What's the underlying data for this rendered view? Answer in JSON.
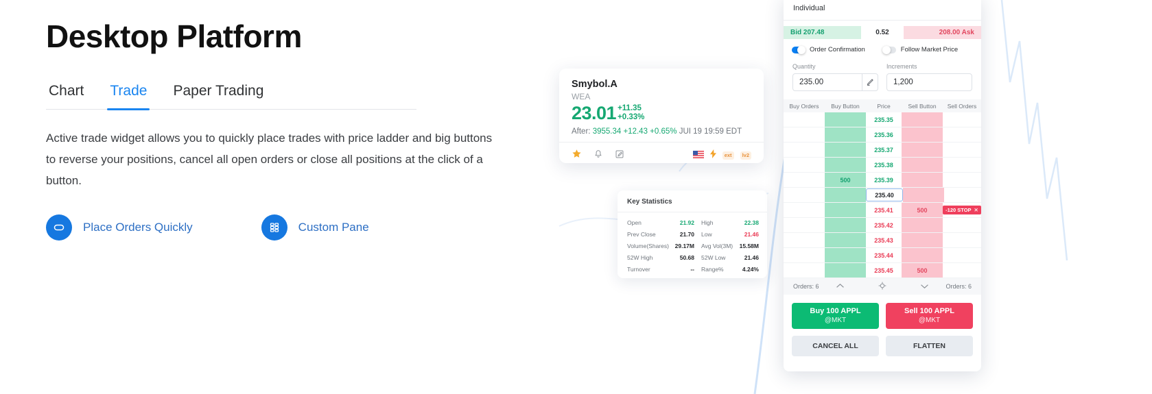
{
  "hero": {
    "title": "Desktop Platform",
    "tabs": [
      {
        "label": "Chart",
        "active": false
      },
      {
        "label": "Trade",
        "active": true
      },
      {
        "label": "Paper Trading",
        "active": false
      }
    ],
    "description": "Active trade widget allows you to quickly place trades with price ladder and big buttons to reverse your positions, cancel all open orders or close all positions at the click of a button.",
    "links": [
      {
        "label": "Place Orders Quickly",
        "icon": "pill-button-icon"
      },
      {
        "label": "Custom Pane",
        "icon": "grid-panes-icon"
      }
    ],
    "accent_color": "#1a85f0",
    "link_color": "#2d6fc4"
  },
  "quote_card": {
    "symbol": "Smybol.A",
    "exchange": "WEA",
    "price": "23.01",
    "change": "+11.35",
    "change_pct": "+0.33%",
    "after_label": "After:",
    "after_price": "3955.34",
    "after_change": "+12.43",
    "after_pct": "+0.65%",
    "after_time": "JUI 19 19:59 EDT",
    "icons": [
      "star-icon",
      "bell-icon",
      "note-edit-icon"
    ],
    "right_icons": [
      "us-flag-icon",
      "lightning-icon",
      "tag-ext-icon",
      "tag-lv2-icon"
    ],
    "tag1": "ext",
    "tag2": "lv2",
    "up_color": "#16a872"
  },
  "key_statistics": {
    "title": "Key Statistics",
    "rows": [
      {
        "l1": "Open",
        "v1": "21.92",
        "v1_color": "green",
        "l2": "High",
        "v2": "22.38",
        "v2_color": "green"
      },
      {
        "l1": "Prev Close",
        "v1": "21.70",
        "v1_color": "dark",
        "l2": "Low",
        "v2": "21.46",
        "v2_color": "red"
      },
      {
        "l1": "Volume(Shares)",
        "v1": "29.17M",
        "v1_color": "dark",
        "l2": "Avg Vol(3M)",
        "v2": "15.58M",
        "v2_color": "dark"
      },
      {
        "l1": "52W High",
        "v1": "50.68",
        "v1_color": "dark",
        "l2": "52W Low",
        "v2": "21.46",
        "v2_color": "dark"
      },
      {
        "l1": "Turnover",
        "v1": "--",
        "v1_color": "dark",
        "l2": "Range%",
        "v2": "4.24%",
        "v2_color": "dark"
      }
    ]
  },
  "trade_panel": {
    "account": "Individual",
    "bid_label": "Bid 207.48",
    "spread": "0.52",
    "ask_label": "208.00  Ask",
    "toggles": [
      {
        "label": "Order Confirmation",
        "on": true
      },
      {
        "label": "Follow Market Price",
        "on": false
      }
    ],
    "quantity_label": "Quantity",
    "quantity_value": "235.00",
    "increments_label": "Increments",
    "increments_value": "1,200",
    "pencil_icon": "pencil-icon",
    "ladder_headers": [
      "Buy Orders",
      "Buy Button",
      "Price",
      "Sell Button",
      "Sell Orders"
    ],
    "ladder_rows": [
      {
        "buy_orders": "",
        "buy_qty": "",
        "price": "235.35",
        "price_side": "buy",
        "sell_qty": "",
        "sell_orders": "",
        "current": false
      },
      {
        "buy_orders": "",
        "buy_qty": "",
        "price": "235.36",
        "price_side": "buy",
        "sell_qty": "",
        "sell_orders": "",
        "current": false
      },
      {
        "buy_orders": "",
        "buy_qty": "",
        "price": "235.37",
        "price_side": "buy",
        "sell_qty": "",
        "sell_orders": "",
        "current": false
      },
      {
        "buy_orders": "",
        "buy_qty": "",
        "price": "235.38",
        "price_side": "buy",
        "sell_qty": "",
        "sell_orders": "",
        "current": false
      },
      {
        "buy_orders": "",
        "buy_qty": "500",
        "price": "235.39",
        "price_side": "buy",
        "sell_qty": "",
        "sell_orders": "",
        "current": false
      },
      {
        "buy_orders": "",
        "buy_qty": "",
        "price": "235.40",
        "price_side": "current",
        "sell_qty": "",
        "sell_orders": "",
        "current": true
      },
      {
        "buy_orders": "",
        "buy_qty": "",
        "price": "235.41",
        "price_side": "sell",
        "sell_qty": "500",
        "sell_orders": "-120 STOP",
        "current": false
      },
      {
        "buy_orders": "",
        "buy_qty": "",
        "price": "235.42",
        "price_side": "sell",
        "sell_qty": "",
        "sell_orders": "",
        "current": false
      },
      {
        "buy_orders": "",
        "buy_qty": "",
        "price": "235.43",
        "price_side": "sell",
        "sell_qty": "",
        "sell_orders": "",
        "current": false
      },
      {
        "buy_orders": "",
        "buy_qty": "",
        "price": "235.44",
        "price_side": "sell",
        "sell_qty": "",
        "sell_orders": "",
        "current": false
      },
      {
        "buy_orders": "",
        "buy_qty": "",
        "price": "235.45",
        "price_side": "sell",
        "sell_qty": "500",
        "sell_orders": "",
        "current": false
      }
    ],
    "footer_left": "Orders: 6",
    "footer_left_count": "6",
    "footer_right": "Orders: 6",
    "footer_icons": [
      "chevron-up-icon",
      "target-icon",
      "chevron-down-icon"
    ],
    "buy_button": {
      "title": "Buy 100 APPL",
      "sub": "@MKT",
      "color": "#0cbb74"
    },
    "sell_button": {
      "title": "Sell 100 APPL",
      "sub": "@MKT",
      "color": "#f0415f"
    },
    "cancel_all": "CANCEL ALL",
    "flatten": "FLATTEN"
  }
}
